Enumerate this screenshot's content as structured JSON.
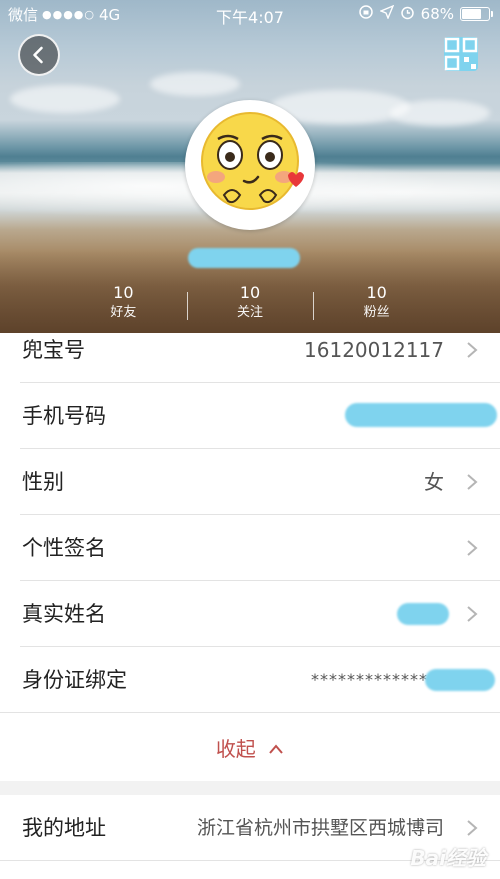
{
  "status_bar": {
    "carrier": "微信",
    "signal": "●●●●○",
    "network": "4G",
    "time": "下午4:07",
    "battery_percent": "68%",
    "battery_level": 0.68
  },
  "header": {
    "back_icon": "back-arrow-icon",
    "qr_icon": "qr-code-icon"
  },
  "stats": [
    {
      "count": "10",
      "label": "好友"
    },
    {
      "count": "10",
      "label": "关注"
    },
    {
      "count": "10",
      "label": "粉丝"
    }
  ],
  "profile_rows": [
    {
      "label": "兜宝号",
      "value": "16120012117"
    },
    {
      "label": "手机号码",
      "value": ""
    },
    {
      "label": "性别",
      "value": "女"
    },
    {
      "label": "个性签名",
      "value": ""
    },
    {
      "label": "真实姓名",
      "value": ""
    },
    {
      "label": "身份证绑定",
      "value": "*************"
    }
  ],
  "collapse_label": "收起",
  "address": {
    "label": "我的地址",
    "value": "浙江省杭州市拱墅区西城博司"
  },
  "watermark": "Bai经验",
  "colors": {
    "accent": "#c0504d",
    "redaction": "#7fd3ee"
  }
}
